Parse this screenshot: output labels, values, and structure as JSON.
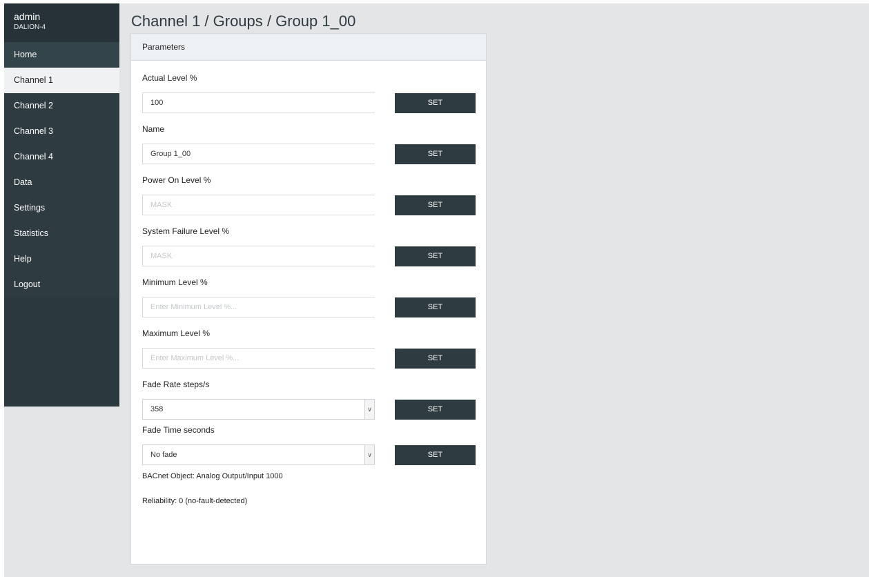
{
  "sidebar": {
    "user": "admin",
    "device": "DALION-4",
    "items": [
      {
        "label": "Home"
      },
      {
        "label": "Channel 1"
      },
      {
        "label": "Channel 2"
      },
      {
        "label": "Channel 3"
      },
      {
        "label": "Channel 4"
      },
      {
        "label": "Data"
      },
      {
        "label": "Settings"
      },
      {
        "label": "Statistics"
      },
      {
        "label": "Help"
      },
      {
        "label": "Logout"
      }
    ]
  },
  "page": {
    "title": "Channel 1 / Groups / Group 1_00"
  },
  "panel": {
    "header": "Parameters",
    "set_label": "SET",
    "fields": {
      "actual_level": {
        "label": "Actual Level %",
        "value": "100",
        "placeholder": ""
      },
      "name": {
        "label": "Name",
        "value": "Group 1_00",
        "placeholder": ""
      },
      "power_on_level": {
        "label": "Power On Level %",
        "value": "",
        "placeholder": "MASK"
      },
      "system_failure_level": {
        "label": "System Failure Level %",
        "value": "",
        "placeholder": "MASK"
      },
      "minimum_level": {
        "label": "Minimum Level %",
        "value": "",
        "placeholder": "Enter Minimum Level %..."
      },
      "maximum_level": {
        "label": "Maximum Level %",
        "value": "",
        "placeholder": "Enter Maximum Level %..."
      },
      "fade_rate": {
        "label": "Fade Rate steps/s",
        "selected": "358"
      },
      "fade_time": {
        "label": "Fade Time seconds",
        "selected": "No fade"
      }
    },
    "bacnet_object": "BACnet Object: Analog Output/Input 1000",
    "reliability": "Reliability: 0 (no-fault-detected)"
  },
  "colors": {
    "sidebar_bg": "#2e3b41",
    "active_item_bg": "#f0f1f2",
    "button_bg": "#2e3b41",
    "page_bg": "#e4e5e7"
  }
}
